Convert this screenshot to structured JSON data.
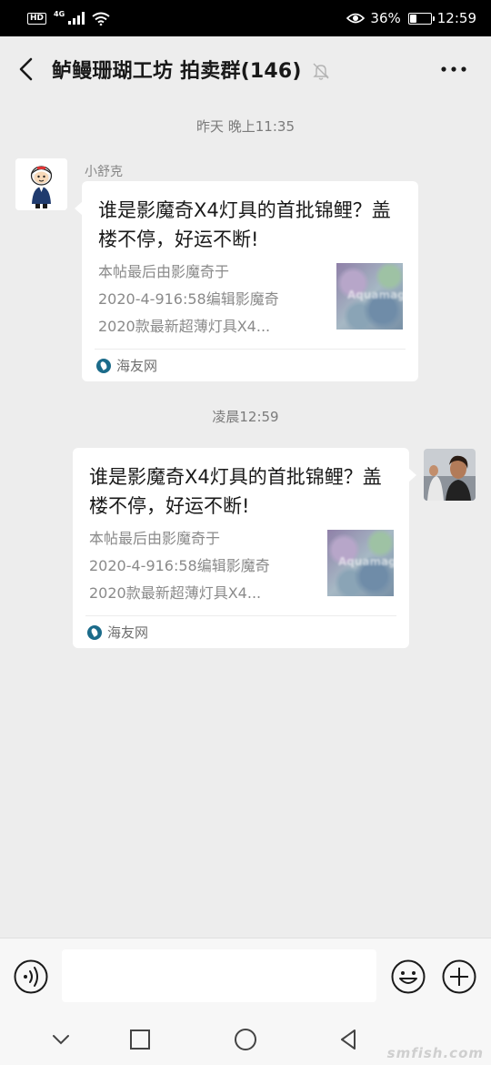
{
  "status_bar": {
    "hd": "HD",
    "network": "4G",
    "battery": "36%",
    "battery_level": 0.36,
    "time": "12:59"
  },
  "header": {
    "title": "鲈鳗珊瑚工坊 拍卖群(146)"
  },
  "messages": [
    {
      "timestamp": "昨天 晚上11:35",
      "sender": "小舒克",
      "side": "left",
      "card": {
        "title": "谁是影魔奇X4灯具的首批锦鲤？盖楼不停，好运不断!",
        "desc_lines": [
          "本帖最后由影魔奇于",
          "2020-4-916:58编辑影魔奇",
          "2020款最新超薄灯具X4..."
        ],
        "source": "海友网",
        "thumb_text": "Aquamagic"
      }
    },
    {
      "timestamp": "凌晨12:59",
      "side": "right",
      "card": {
        "title": "谁是影魔奇X4灯具的首批锦鲤？盖楼不停，好运不断!",
        "desc_lines": [
          "本帖最后由影魔奇于",
          "2020-4-916:58编辑影魔奇",
          "2020款最新超薄灯具X4..."
        ],
        "source": "海友网",
        "thumb_text": "Aquamagic"
      }
    }
  ],
  "input": {
    "value": "",
    "placeholder": ""
  },
  "watermark": "smfish.com",
  "icons": {
    "back": "chevron-left-icon",
    "mute": "bell-off-icon",
    "more": "more-dots-icon",
    "voice": "voice-icon",
    "emoji": "emoji-icon",
    "plus": "plus-circle-icon"
  }
}
